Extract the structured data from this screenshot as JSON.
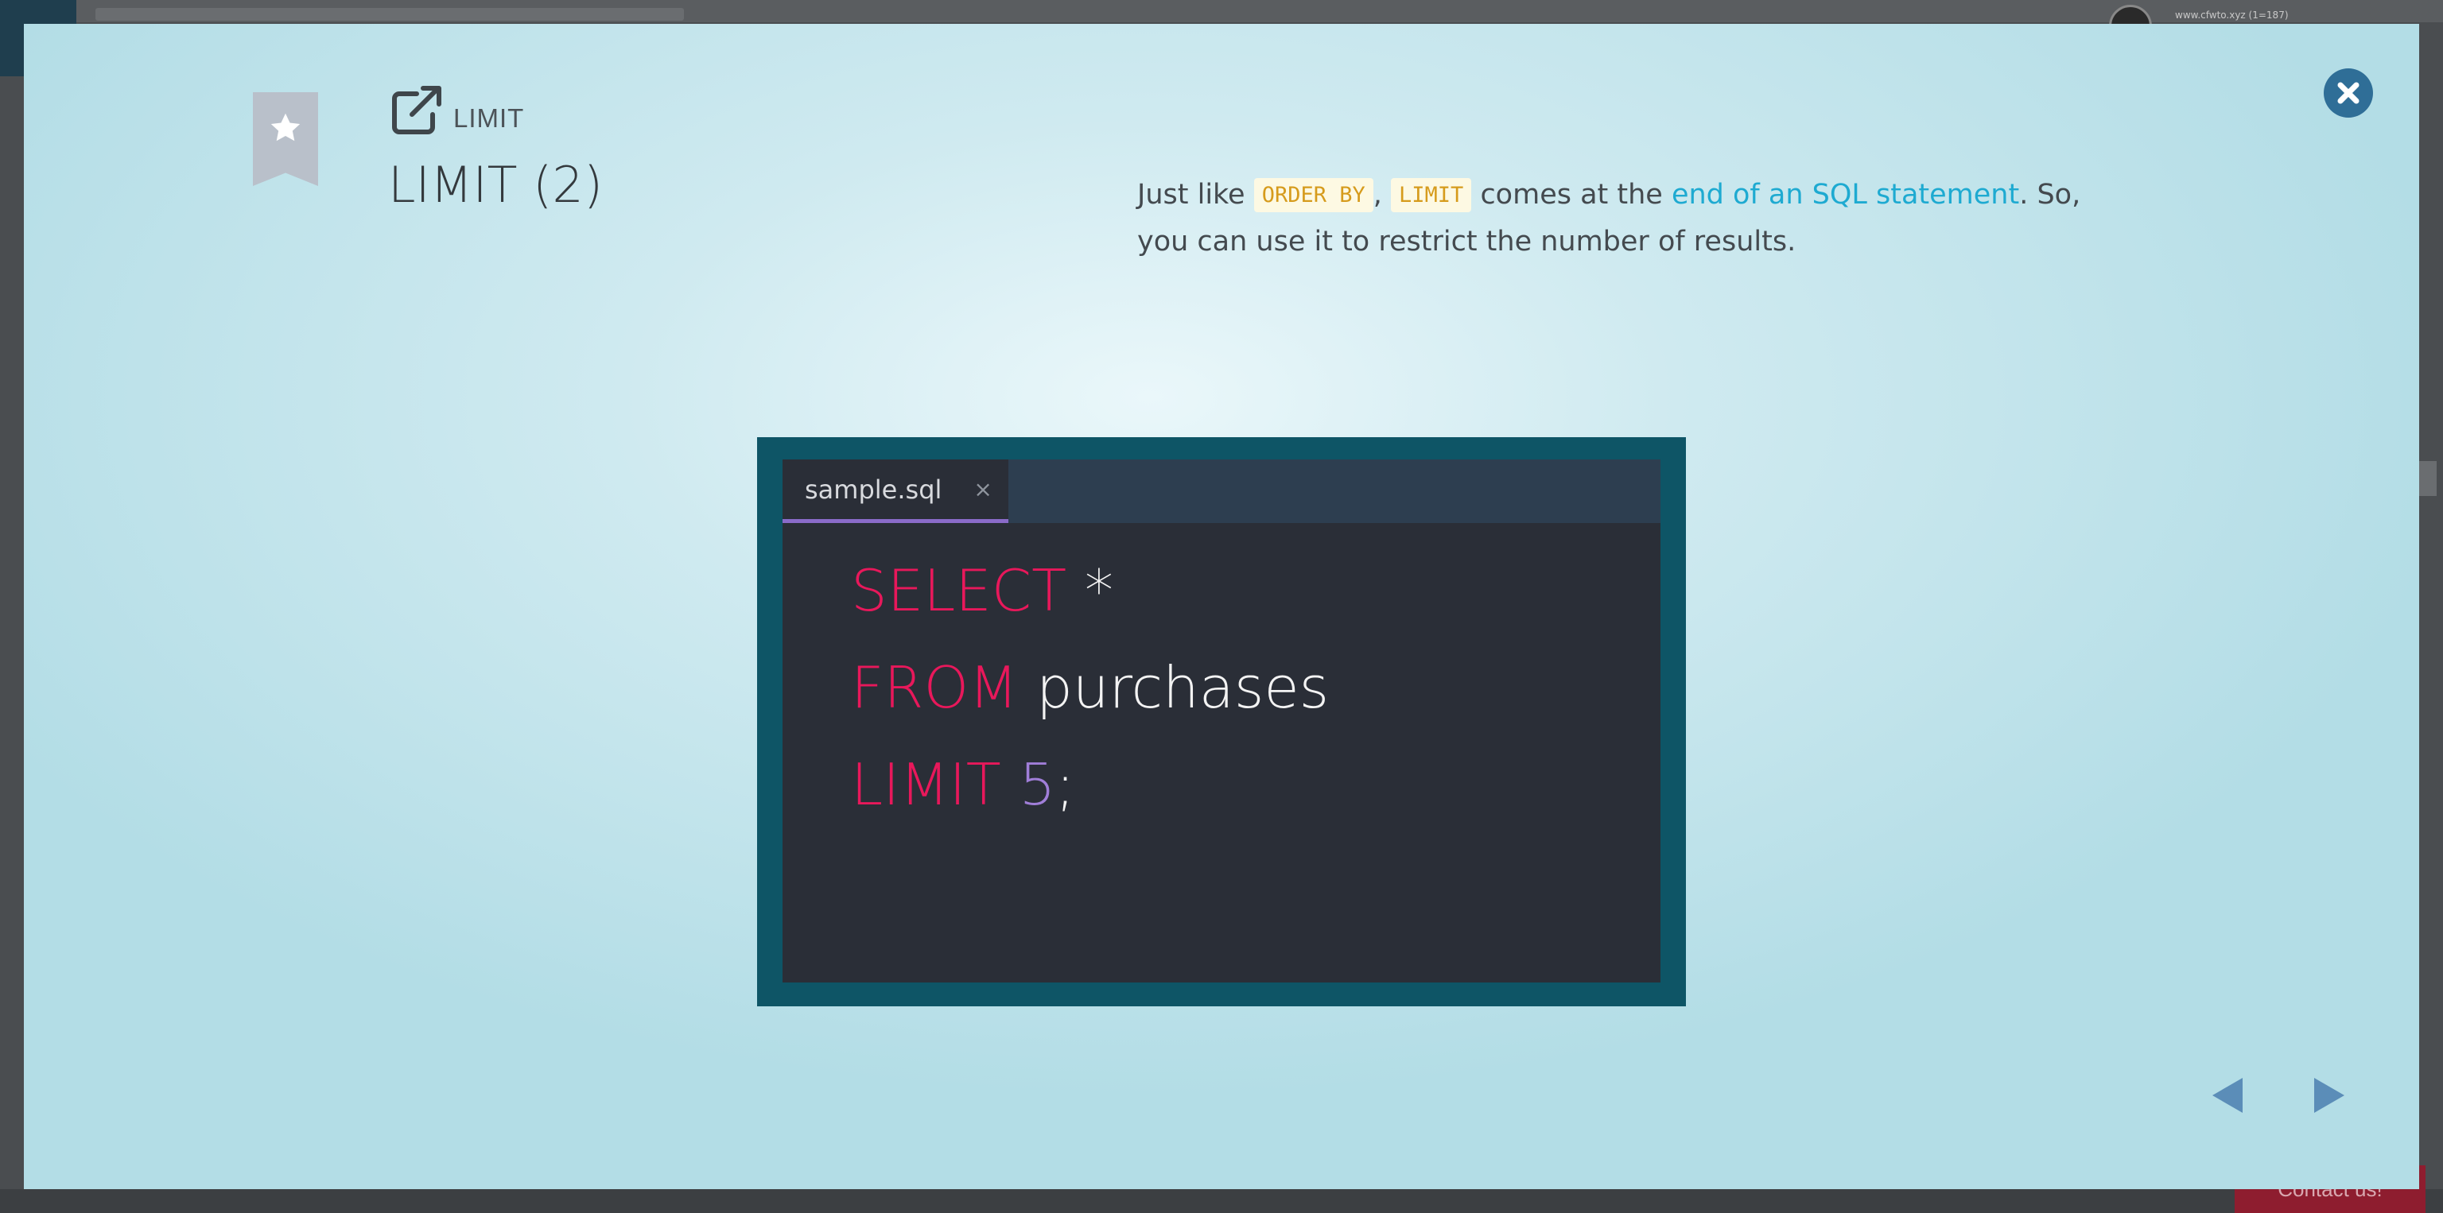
{
  "background": {
    "user_text": "www.cfwto.xyz (1=187)",
    "contact_label": "Contact us!"
  },
  "card": {
    "topic_label": "LIMIT",
    "title": "LIMIT (2)",
    "description": {
      "part1": "Just like ",
      "code1": "ORDER BY",
      "part2": ", ",
      "code2": "LIMIT",
      "part3": " comes at the ",
      "link_text": "end of an SQL statement",
      "part4": ". So, you can use it to restrict the number of results."
    }
  },
  "editor": {
    "tab_name": "sample.sql",
    "tab_close": "×",
    "code": {
      "line1_kw": "SELECT",
      "line1_rest": "*",
      "line2_kw": "FROM",
      "line2_rest": "purchases",
      "line3_kw": "LIMIT",
      "line3_num": "5",
      "line3_end": ";"
    }
  },
  "icons": {
    "bookmark": "bookmark-star-icon",
    "external_link": "external-link-icon",
    "close": "close-icon",
    "prev": "arrow-left-icon",
    "next": "arrow-right-icon"
  },
  "colors": {
    "keyword": "#e8185b",
    "number": "#a07ed8",
    "link": "#1eaad1",
    "code_chip_text": "#d69b1c",
    "editor_bg": "#2a2e37",
    "editor_frame": "#0e5566",
    "close_button": "#2f6e97",
    "nav_arrow": "#5b8db8"
  }
}
